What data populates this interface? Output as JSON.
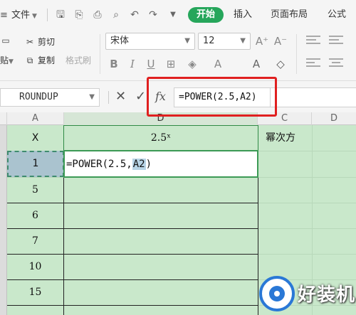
{
  "toolbar": {
    "file_menu": "文件",
    "tabs": [
      "开始",
      "插入",
      "页面布局",
      "公式"
    ]
  },
  "ribbon": {
    "cut": "剪切",
    "copy": "复制",
    "format_painter": "格式刷",
    "paste": "贴",
    "font_name": "宋体",
    "font_size": "12"
  },
  "formula_bar": {
    "name_box": "ROUNDUP",
    "fx": "fx",
    "formula": "=POWER(2.5,A2)"
  },
  "grid": {
    "columns": [
      "A",
      "D",
      "C",
      "D"
    ],
    "selected_column": "D",
    "header_row": {
      "a": "X",
      "b": "2.5ˣ",
      "c": "幂次方"
    },
    "editing_formula": {
      "prefix": "=POWER(2.5,",
      "ref": "A2",
      "suffix": ")"
    },
    "x_values": [
      "1",
      "5",
      "6",
      "7",
      "10",
      "15"
    ]
  },
  "watermark": {
    "text": "好装机"
  }
}
